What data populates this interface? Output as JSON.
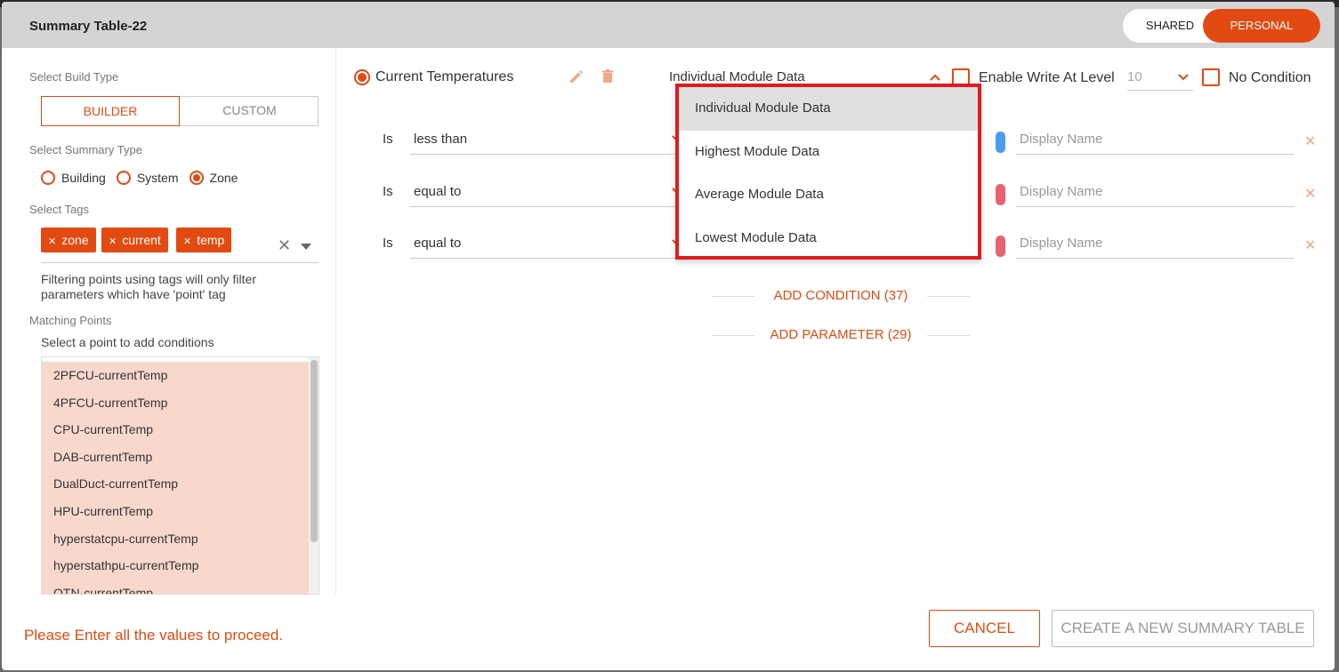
{
  "window": {
    "title": "Summary Table-22"
  },
  "scope_toggle": {
    "shared": "SHARED",
    "personal": "PERSONAL",
    "active": "PERSONAL"
  },
  "build_type": {
    "label": "Select Build Type",
    "builder": "BUILDER",
    "custom": "CUSTOM",
    "active": "BUILDER"
  },
  "summary_type": {
    "label": "Select Summary Type",
    "options": [
      "Building",
      "System",
      "Zone"
    ],
    "selected": "Zone"
  },
  "tags": {
    "label": "Select Tags",
    "chips": [
      "zone",
      "current",
      "temp"
    ]
  },
  "tag_note": "Filtering points using tags will only filter parameters which have 'point' tag",
  "matching_points": {
    "label": "Matching Points",
    "hint": "Select a point to add conditions",
    "items": [
      "2PFCU-currentTemp",
      "4PFCU-currentTemp",
      "CPU-currentTemp",
      "DAB-currentTemp",
      "DualDuct-currentTemp",
      "HPU-currentTemp",
      "hyperstatcpu-currentTemp",
      "hyperstathpu-currentTemp",
      "OTN-currentTemp"
    ]
  },
  "parameter": {
    "name": "Current Temperatures",
    "module_select": "Individual Module Data",
    "enable_write_label": "Enable Write At Level",
    "level_value": "10",
    "no_condition_label": "No Condition",
    "pencil_icon": "pencil-icon",
    "trash_icon": "trash-icon"
  },
  "conditions": [
    {
      "is": "Is",
      "operator": "less than",
      "color": "#4a9ded",
      "display_placeholder": "Display Name"
    },
    {
      "is": "Is",
      "operator": "equal to",
      "color": "#e8636f",
      "display_placeholder": "Display Name"
    },
    {
      "is": "Is",
      "operator": "equal to",
      "color": "#e8636f",
      "display_placeholder": "Display Name"
    }
  ],
  "add_condition": "ADD CONDITION (37)",
  "add_parameter": "ADD PARAMETER (29)",
  "dropdown": {
    "options": [
      "Individual Module Data",
      "Highest Module Data",
      "Average Module Data",
      "Lowest Module Data"
    ],
    "highlighted": "Individual Module Data"
  },
  "footer": {
    "error": "Please Enter all the values to proceed.",
    "cancel": "CANCEL",
    "create": "CREATE A NEW SUMMARY TABLE"
  },
  "colors": {
    "accent": "#e24a12",
    "highlight_border": "#e01b22"
  }
}
